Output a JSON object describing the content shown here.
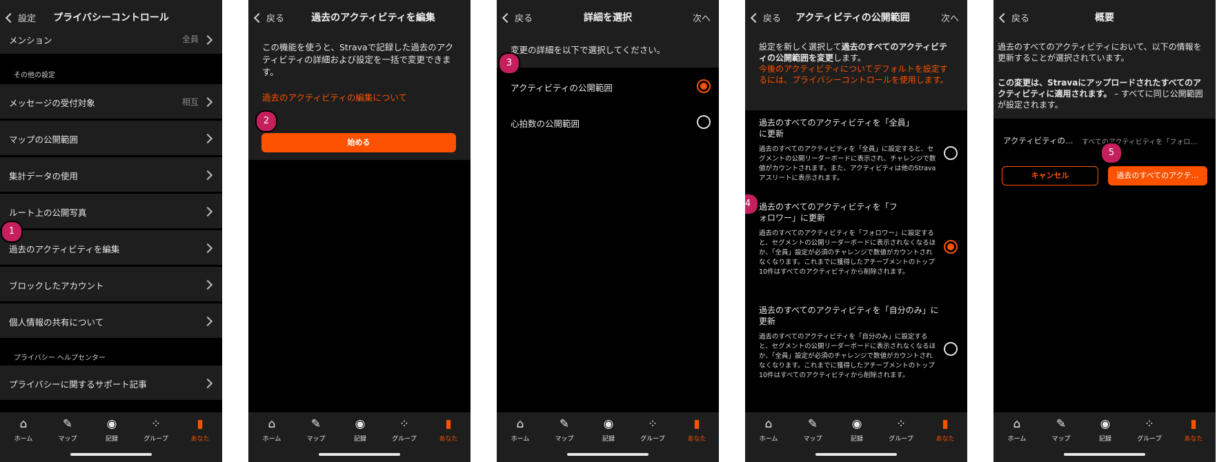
{
  "tabs": [
    {
      "label": "ホーム",
      "icon": "home-icon",
      "glyph": "⌂"
    },
    {
      "label": "マップ",
      "icon": "map-pen-icon",
      "glyph": "✎"
    },
    {
      "label": "記録",
      "icon": "record-icon",
      "glyph": "◉"
    },
    {
      "label": "グループ",
      "icon": "group-dots-icon",
      "glyph": "⁘"
    },
    {
      "label": "あなた",
      "icon": "you-bar-icon",
      "glyph": "▮"
    }
  ],
  "colors": {
    "accent": "#fc5200",
    "step_badge": "#c51f5d",
    "surface": "#1e1e1e",
    "background": "#000000"
  },
  "screen1": {
    "back_label": "設定",
    "title": "プライバシーコントロール",
    "mention": {
      "label": "メンション",
      "value": "全員"
    },
    "other_header": "その他の設定",
    "rows": [
      {
        "label": "メッセージの受付対象",
        "value": "相互"
      },
      {
        "label": "マップの公開範囲",
        "value": ""
      },
      {
        "label": "集計データの使用",
        "value": ""
      },
      {
        "label": "ルート上の公開写真",
        "value": ""
      },
      {
        "label": "過去のアクティビティを編集",
        "value": ""
      },
      {
        "label": "ブロックしたアカウント",
        "value": ""
      },
      {
        "label": "個人情報の共有について",
        "value": ""
      }
    ],
    "help_header": "プライバシー ヘルプセンター",
    "help_row": "プライバシーに関するサポート記事",
    "step": "1"
  },
  "screen2": {
    "back_label": "戻る",
    "title": "過去のアクティビティを編集",
    "body": "この機能を使うと、Stravaで記録した過去のアクティビティの詳細および設定を一括で変更できます。",
    "link": "過去のアクティビティの編集について",
    "button": "始める",
    "step": "2"
  },
  "screen3": {
    "back_label": "戻る",
    "title": "詳細を選択",
    "next_label": "次へ",
    "prompt": "変更の詳細を以下で選択してください。",
    "options": [
      {
        "label": "アクティビティの公開範囲",
        "selected": true
      },
      {
        "label": "心拍数の公開範囲",
        "selected": false
      }
    ],
    "step": "3"
  },
  "screen4": {
    "back_label": "戻る",
    "title": "アクティビティの公開範囲",
    "next_label": "次へ",
    "intro_pre": "設定を新しく選択して",
    "intro_bold": "過去のすべてのアクティビティの公開範囲を変更",
    "intro_post": "します。",
    "intro_orange": "今後のアクティビティについてデフォルトを設定するには、プライバシーコントロールを使用します。",
    "options": [
      {
        "title": "過去のすべてのアクティビティを「全員」に更新",
        "desc": "過去のすべてのアクティビティを「全員」に設定すると、セグメントの公開リーダーボードに表示され、チャレンジで数値がカウントされます。また、アクティビティは他のStravaアスリートに表示されます。",
        "selected": false
      },
      {
        "title": "過去のすべてのアクティビティを「フォロワー」に更新",
        "desc": "過去のすべてのアクティビティを「フォロワー」に設定すると、セグメントの公開リーダーボードに表示されなくなるほか、「全員」設定が必須のチャレンジで数値がカウントされなくなります。これまでに獲得したアチーブメントのトップ10件はすべてのアクティビティから削除されます。",
        "selected": true
      },
      {
        "title": "過去のすべてのアクティビティを「自分のみ」に更新",
        "desc": "過去のすべてのアクティビティを「自分のみ」に設定すると、セグメントの公開リーダーボードに表示されなくなるほか、「全員」設定が必須のチャレンジで数値がカウントされなくなります。これまでに獲得したアチーブメントのトップ10件はすべてのアクティビティから削除されます。",
        "selected": false
      }
    ],
    "step": "4"
  },
  "screen5": {
    "back_label": "戻る",
    "title": "概要",
    "para1": "過去のすべてのアクティビティにおいて、以下の情報を更新することが選択されています。",
    "para2_bold": "この変更は、Stravaにアップロードされたすべてのアクティビティに適用されます。",
    "para2_rest": " – すべてに同じ公開範囲が設定されます。",
    "summary_key": "アクティビティの…",
    "summary_value": "すべてのアクティビティを「フォロ…",
    "cancel": "キャンセル",
    "confirm": "過去のすべてのアクテ…",
    "step": "5"
  }
}
